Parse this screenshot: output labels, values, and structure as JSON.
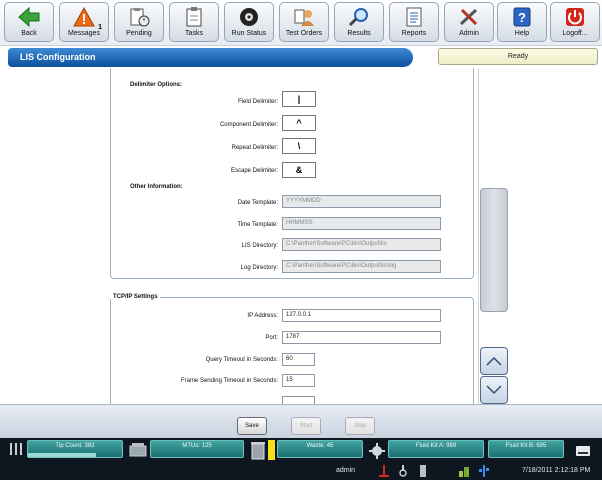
{
  "toolbar": [
    {
      "label": "Back",
      "icon": "arrow-left-icon"
    },
    {
      "label": "Messages",
      "icon": "warning-icon",
      "badge": "1"
    },
    {
      "label": "Pending",
      "icon": "clipboard-clock-icon"
    },
    {
      "label": "Tasks",
      "icon": "clipboard-icon"
    },
    {
      "label": "Run Status",
      "icon": "disc-icon"
    },
    {
      "label": "Test Orders",
      "icon": "user-icon"
    },
    {
      "label": "Results",
      "icon": "magnifier-icon"
    },
    {
      "label": "Reports",
      "icon": "document-icon"
    },
    {
      "label": "Admin",
      "icon": "tools-icon"
    },
    {
      "label": "Help",
      "icon": "question-icon"
    },
    {
      "label": "Logoff...",
      "icon": "power-icon"
    }
  ],
  "header": {
    "title": "LIS Configuration",
    "status": "Ready"
  },
  "delimiters": {
    "heading": "Delimiter Options:",
    "field_label": "Field Delimiter:",
    "field_value": "|",
    "component_label": "Component Delimiter:",
    "component_value": "^",
    "repeat_label": "Repeat Delimiter:",
    "repeat_value": "\\",
    "escape_label": "Escape Delimiter:",
    "escape_value": "&"
  },
  "other": {
    "heading": "Other Information:",
    "date_label": "Date Template:",
    "date_value": "YYYYMMDD",
    "time_label": "Time Template:",
    "time_value": "HHMMSS",
    "lisdir_label": "LIS Directory:",
    "lisdir_value": "C:\\Panther\\Software\\PC\\bin\\Output\\lis",
    "logdir_label": "Log Directory:",
    "logdir_value": "C:\\Panther\\Software\\PC\\bin\\Output\\lis\\log"
  },
  "tcpip": {
    "heading": "TCP/IP Settings",
    "ip_label": "IP Address:",
    "ip_value": "127.0.0.1",
    "port_label": "Port:",
    "port_value": "1787",
    "query_label": "Query Timeout in Seconds:",
    "query_value": "60",
    "frame_label": "Frame Sending Timeout in Seconds:",
    "frame_value": "15"
  },
  "actions": {
    "save": "Save",
    "start": "Start",
    "stop": "Stop"
  },
  "footer": {
    "tip_count": "Tip Count: 382",
    "mtus": "MTUs: 125",
    "waste": "Waste: 45",
    "fluid_a": "Fluid Kit A: 989",
    "fluid_b": "Fluid Kit B: 695",
    "user": "admin",
    "datetime": "7/18/2011 2:12:18 PM"
  },
  "colors": {
    "accent": "#0d4f9c",
    "status_teal": "#2a8a88",
    "footer_bg": "#0e1620"
  }
}
